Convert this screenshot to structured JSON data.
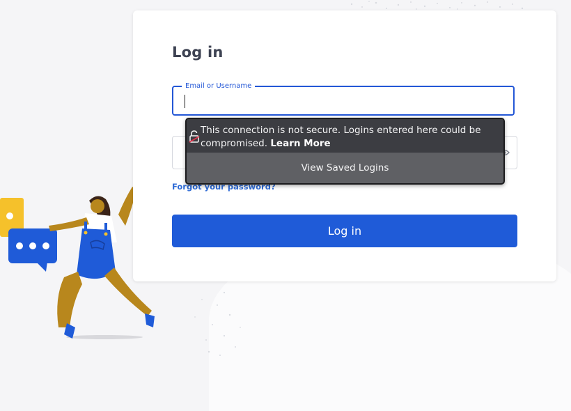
{
  "login_form": {
    "title": "Log in",
    "email_label": "Email or Username",
    "email_value": "",
    "password_value": "",
    "forgot_password_link": "Forgot your password?",
    "submit_label": "Log in"
  },
  "insecure_popup": {
    "message": "This connection is not secure. Logins entered here could be compromised.",
    "learn_more_link": "Learn More",
    "view_saved_logins_button": "View Saved Logins"
  },
  "icons": {
    "insecure_lock": "broken-lock-icon",
    "password_toggle": "eye-icon",
    "chat_bubble": "chat-bubble-icon"
  },
  "colors": {
    "primary_button": "#1f5bd8",
    "focus_border": "#2357d6",
    "link": "#2e6bd6",
    "popup_background": "#3c3d42",
    "title_text": "#3d4252"
  }
}
